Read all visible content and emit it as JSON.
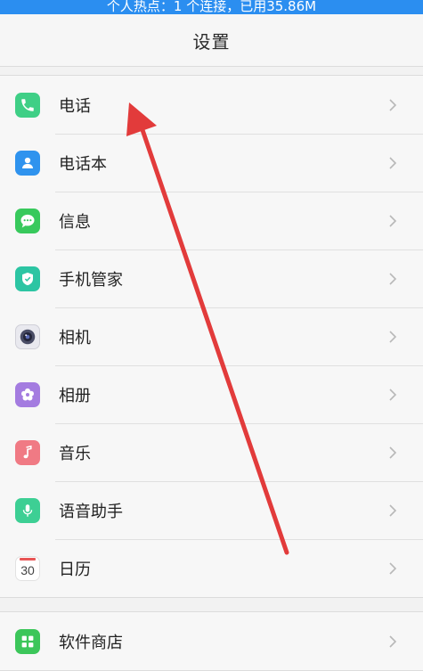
{
  "status_bar": {
    "hotspot_text": "个人热点：1 个连接，已用35.86M"
  },
  "header": {
    "title": "设置"
  },
  "groups": [
    {
      "items": [
        {
          "label": "电话",
          "icon": "phone-icon",
          "color": "#3fcf86"
        },
        {
          "label": "电话本",
          "icon": "contacts-icon",
          "color": "#2f93ee"
        },
        {
          "label": "信息",
          "icon": "message-icon",
          "color": "#38c95c"
        },
        {
          "label": "手机管家",
          "icon": "shield-icon",
          "color": "#2cc5a3"
        },
        {
          "label": "相机",
          "icon": "camera-icon",
          "color": "#e9e9ef"
        },
        {
          "label": "相册",
          "icon": "gallery-icon",
          "color": "#a47ce0"
        },
        {
          "label": "音乐",
          "icon": "music-icon",
          "color": "#f07a84"
        },
        {
          "label": "语音助手",
          "icon": "microphone-icon",
          "color": "#3dcf94"
        },
        {
          "label": "日历",
          "icon": "calendar-icon",
          "color": "#ffffff",
          "calendar_day": "30"
        }
      ]
    },
    {
      "items": [
        {
          "label": "软件商店",
          "icon": "app-store-icon",
          "color": "#3cc65a"
        }
      ]
    }
  ],
  "colors": {
    "status_bar": "#2b8ef0",
    "annotation_arrow": "#e23b3b",
    "chevron": "#b8b8b8"
  }
}
